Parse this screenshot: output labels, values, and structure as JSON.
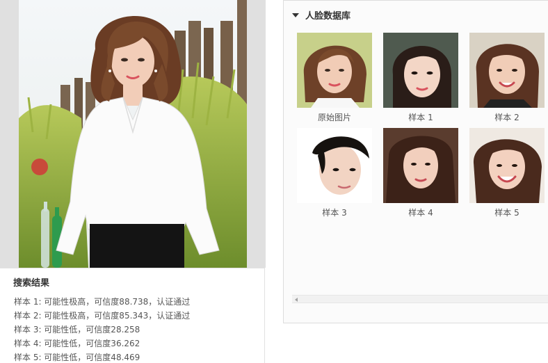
{
  "results": {
    "title": "搜索结果",
    "lines": [
      "样本 1: 可能性极高，可信度88.738，认证通过",
      "样本 2: 可能性极高，可信度85.343，认证通过",
      "样本 3: 可能性低，可信度28.258",
      "样本 4: 可能性低，可信度36.262",
      "样本 5: 可能性低，可信度48.469"
    ]
  },
  "database": {
    "title": "人脸数据库",
    "items": [
      {
        "label": "原始图片"
      },
      {
        "label": "样本 1"
      },
      {
        "label": "样本 2"
      },
      {
        "label": "样本 3"
      },
      {
        "label": "样本 4"
      },
      {
        "label": "样本 5"
      }
    ]
  },
  "colors": {
    "photo_background": "#e0e0e0",
    "panel_background": "#fbfbfb",
    "text": "#333333"
  },
  "icons": {
    "collapse": "caret-down-icon",
    "scroll_left": "arrow-left-icon"
  }
}
